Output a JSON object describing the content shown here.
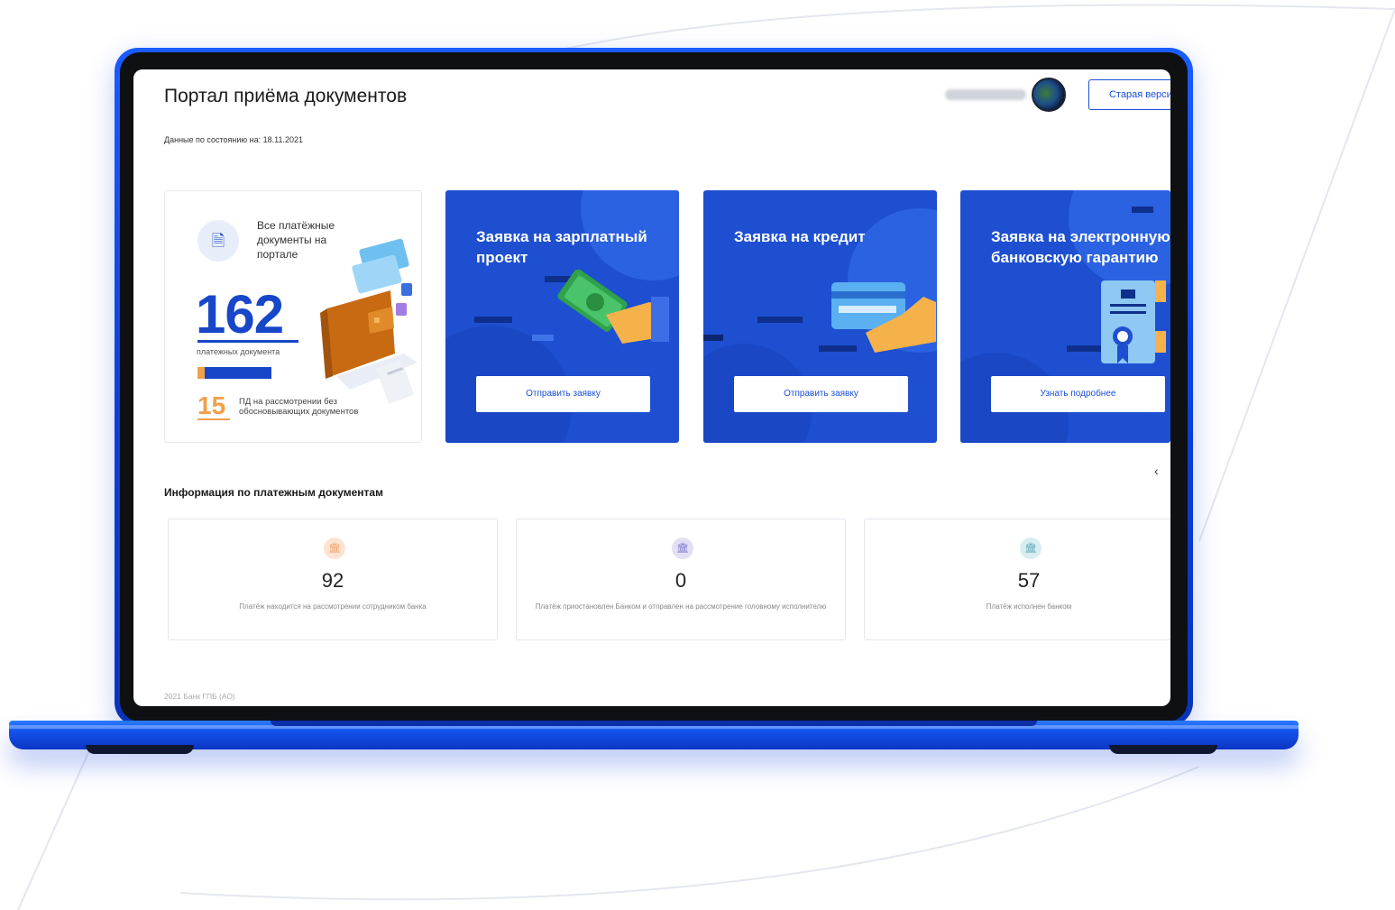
{
  "header": {
    "title": "Портал приёма документов",
    "old_version_button": "Старая верси"
  },
  "date_line": "Данные по состоянию на: 18.11.2021",
  "summary_card": {
    "label": "Все платёжные документы на портале",
    "total_count": "162",
    "total_label": "платежных документа",
    "review_count": "15",
    "review_label": "ПД на рассмотрении без обосновывающих документов",
    "icon": "document-icon"
  },
  "promo_cards": [
    {
      "title": "Заявка на зарплатный проект",
      "button": "Отправить заявку",
      "icon": "money-hand-icon"
    },
    {
      "title": "Заявка на кредит",
      "button": "Отправить заявку",
      "icon": "credit-card-hand-icon"
    },
    {
      "title": "Заявка на электронную банковскую гарантию",
      "button": "Узнать подробнее",
      "icon": "certificate-icon"
    }
  ],
  "carousel_arrow": "‹",
  "section": {
    "title": "Информация по платежным документам"
  },
  "stats": [
    {
      "value": "92",
      "desc": "Платёж находится на рассмотрении сотрудником банка",
      "icon": "bank-icon",
      "color": "#f2a36b"
    },
    {
      "value": "0",
      "desc": "Платёж приостановлен Банком и отправлен на рассмотрение головному исполнителю",
      "icon": "bank-icon",
      "color": "#7f78c9"
    },
    {
      "value": "57",
      "desc": "Платёж исполнен банком",
      "icon": "bank-icon",
      "color": "#5aa8b8"
    }
  ],
  "footer": "2021 Банк ГПБ (АО)",
  "colors": {
    "primary": "#1b4fd8",
    "accent": "#f0a04b"
  }
}
